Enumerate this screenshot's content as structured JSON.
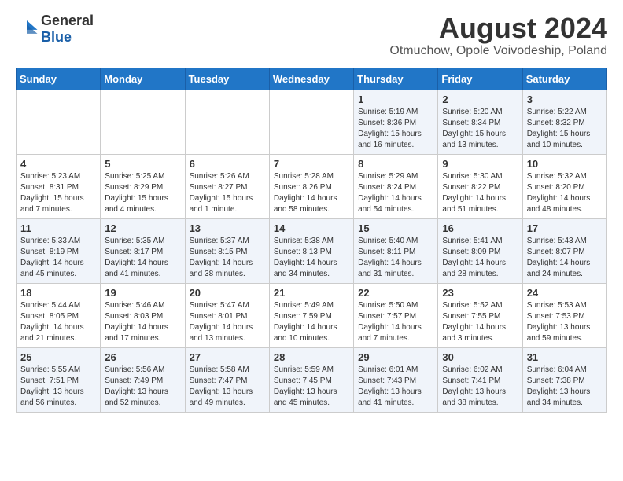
{
  "header": {
    "logo_general": "General",
    "logo_blue": "Blue",
    "main_title": "August 2024",
    "subtitle": "Otmuchow, Opole Voivodeship, Poland"
  },
  "days_of_week": [
    "Sunday",
    "Monday",
    "Tuesday",
    "Wednesday",
    "Thursday",
    "Friday",
    "Saturday"
  ],
  "weeks": [
    [
      {
        "day": "",
        "info": ""
      },
      {
        "day": "",
        "info": ""
      },
      {
        "day": "",
        "info": ""
      },
      {
        "day": "",
        "info": ""
      },
      {
        "day": "1",
        "info": "Sunrise: 5:19 AM\nSunset: 8:36 PM\nDaylight: 15 hours and 16 minutes."
      },
      {
        "day": "2",
        "info": "Sunrise: 5:20 AM\nSunset: 8:34 PM\nDaylight: 15 hours and 13 minutes."
      },
      {
        "day": "3",
        "info": "Sunrise: 5:22 AM\nSunset: 8:32 PM\nDaylight: 15 hours and 10 minutes."
      }
    ],
    [
      {
        "day": "4",
        "info": "Sunrise: 5:23 AM\nSunset: 8:31 PM\nDaylight: 15 hours and 7 minutes."
      },
      {
        "day": "5",
        "info": "Sunrise: 5:25 AM\nSunset: 8:29 PM\nDaylight: 15 hours and 4 minutes."
      },
      {
        "day": "6",
        "info": "Sunrise: 5:26 AM\nSunset: 8:27 PM\nDaylight: 15 hours and 1 minute."
      },
      {
        "day": "7",
        "info": "Sunrise: 5:28 AM\nSunset: 8:26 PM\nDaylight: 14 hours and 58 minutes."
      },
      {
        "day": "8",
        "info": "Sunrise: 5:29 AM\nSunset: 8:24 PM\nDaylight: 14 hours and 54 minutes."
      },
      {
        "day": "9",
        "info": "Sunrise: 5:30 AM\nSunset: 8:22 PM\nDaylight: 14 hours and 51 minutes."
      },
      {
        "day": "10",
        "info": "Sunrise: 5:32 AM\nSunset: 8:20 PM\nDaylight: 14 hours and 48 minutes."
      }
    ],
    [
      {
        "day": "11",
        "info": "Sunrise: 5:33 AM\nSunset: 8:19 PM\nDaylight: 14 hours and 45 minutes."
      },
      {
        "day": "12",
        "info": "Sunrise: 5:35 AM\nSunset: 8:17 PM\nDaylight: 14 hours and 41 minutes."
      },
      {
        "day": "13",
        "info": "Sunrise: 5:37 AM\nSunset: 8:15 PM\nDaylight: 14 hours and 38 minutes."
      },
      {
        "day": "14",
        "info": "Sunrise: 5:38 AM\nSunset: 8:13 PM\nDaylight: 14 hours and 34 minutes."
      },
      {
        "day": "15",
        "info": "Sunrise: 5:40 AM\nSunset: 8:11 PM\nDaylight: 14 hours and 31 minutes."
      },
      {
        "day": "16",
        "info": "Sunrise: 5:41 AM\nSunset: 8:09 PM\nDaylight: 14 hours and 28 minutes."
      },
      {
        "day": "17",
        "info": "Sunrise: 5:43 AM\nSunset: 8:07 PM\nDaylight: 14 hours and 24 minutes."
      }
    ],
    [
      {
        "day": "18",
        "info": "Sunrise: 5:44 AM\nSunset: 8:05 PM\nDaylight: 14 hours and 21 minutes."
      },
      {
        "day": "19",
        "info": "Sunrise: 5:46 AM\nSunset: 8:03 PM\nDaylight: 14 hours and 17 minutes."
      },
      {
        "day": "20",
        "info": "Sunrise: 5:47 AM\nSunset: 8:01 PM\nDaylight: 14 hours and 13 minutes."
      },
      {
        "day": "21",
        "info": "Sunrise: 5:49 AM\nSunset: 7:59 PM\nDaylight: 14 hours and 10 minutes."
      },
      {
        "day": "22",
        "info": "Sunrise: 5:50 AM\nSunset: 7:57 PM\nDaylight: 14 hours and 7 minutes."
      },
      {
        "day": "23",
        "info": "Sunrise: 5:52 AM\nSunset: 7:55 PM\nDaylight: 14 hours and 3 minutes."
      },
      {
        "day": "24",
        "info": "Sunrise: 5:53 AM\nSunset: 7:53 PM\nDaylight: 13 hours and 59 minutes."
      }
    ],
    [
      {
        "day": "25",
        "info": "Sunrise: 5:55 AM\nSunset: 7:51 PM\nDaylight: 13 hours and 56 minutes."
      },
      {
        "day": "26",
        "info": "Sunrise: 5:56 AM\nSunset: 7:49 PM\nDaylight: 13 hours and 52 minutes."
      },
      {
        "day": "27",
        "info": "Sunrise: 5:58 AM\nSunset: 7:47 PM\nDaylight: 13 hours and 49 minutes."
      },
      {
        "day": "28",
        "info": "Sunrise: 5:59 AM\nSunset: 7:45 PM\nDaylight: 13 hours and 45 minutes."
      },
      {
        "day": "29",
        "info": "Sunrise: 6:01 AM\nSunset: 7:43 PM\nDaylight: 13 hours and 41 minutes."
      },
      {
        "day": "30",
        "info": "Sunrise: 6:02 AM\nSunset: 7:41 PM\nDaylight: 13 hours and 38 minutes."
      },
      {
        "day": "31",
        "info": "Sunrise: 6:04 AM\nSunset: 7:38 PM\nDaylight: 13 hours and 34 minutes."
      }
    ]
  ]
}
